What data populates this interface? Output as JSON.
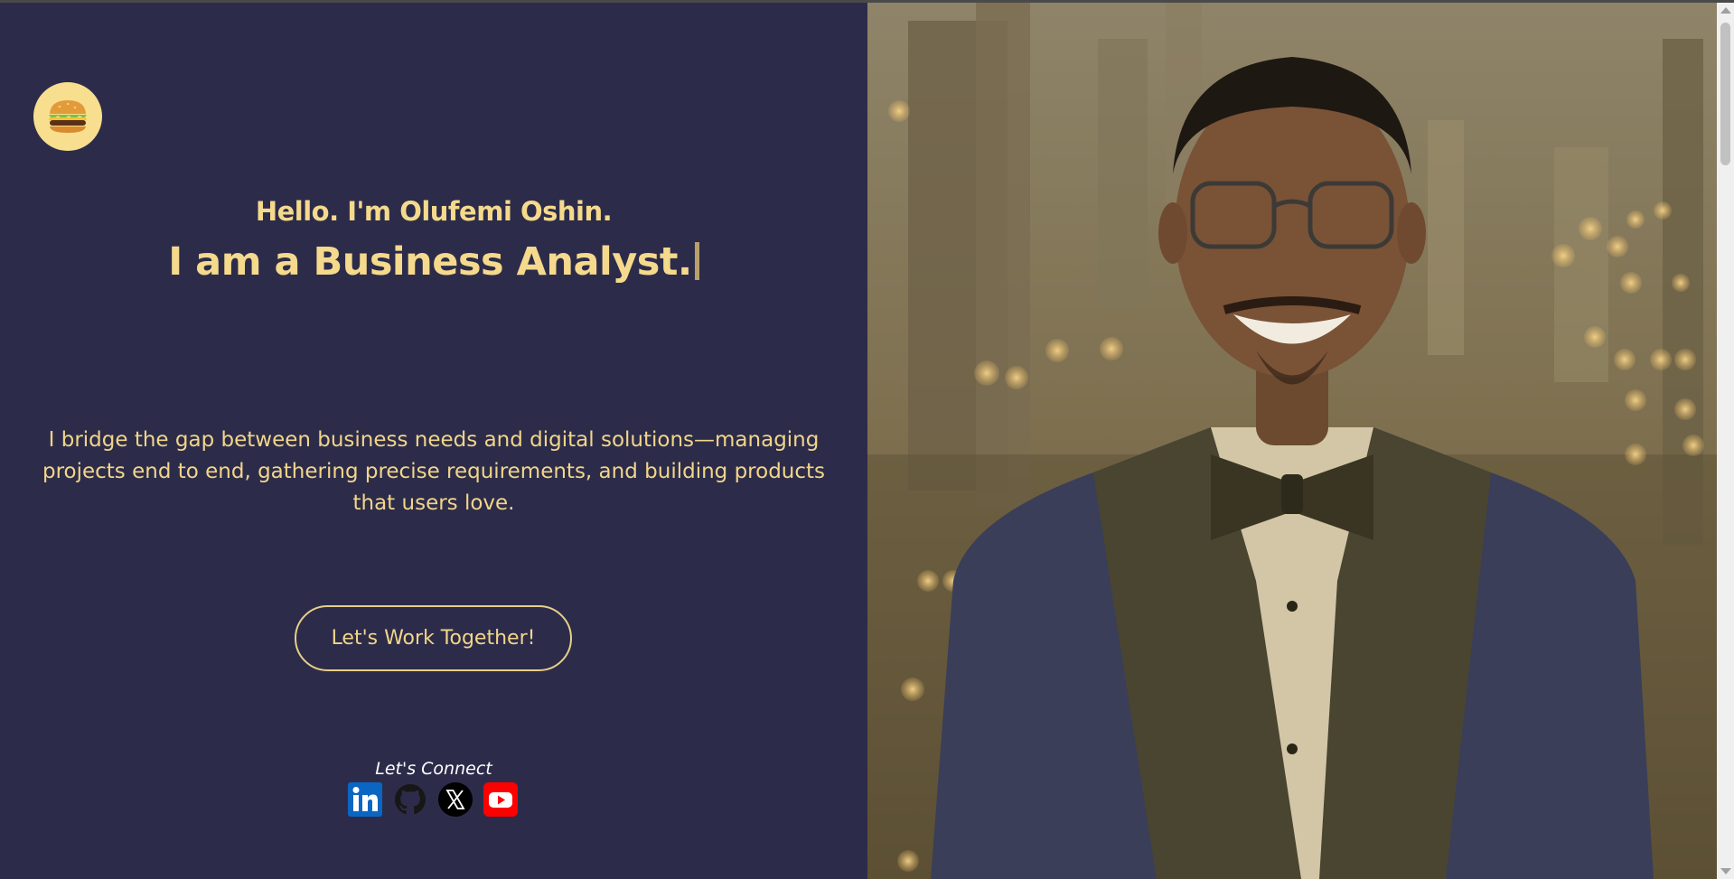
{
  "logo": {
    "icon": "burger-icon",
    "glyph": "🍔"
  },
  "hero": {
    "greeting": "Hello. I'm Olufemi Oshin.",
    "headline": "I am a Business Analyst.",
    "description": "I bridge the gap between business needs and digital solutions—managing projects end to end, gathering precise requirements, and building products that users love.",
    "cta_label": "Let's Work Together!"
  },
  "connect": {
    "label": "Let's Connect",
    "socials": [
      {
        "name": "LinkedIn",
        "icon": "linkedin-icon",
        "color": "#0a66c2"
      },
      {
        "name": "GitHub",
        "icon": "github-icon",
        "color": "#181717"
      },
      {
        "name": "X",
        "icon": "x-icon",
        "color": "#000000"
      },
      {
        "name": "YouTube",
        "icon": "youtube-icon",
        "color": "#ff0000"
      }
    ]
  },
  "colors": {
    "left_background": "#2c2c4a",
    "accent": "#f5d98c",
    "logo_background": "#f7df8f"
  }
}
